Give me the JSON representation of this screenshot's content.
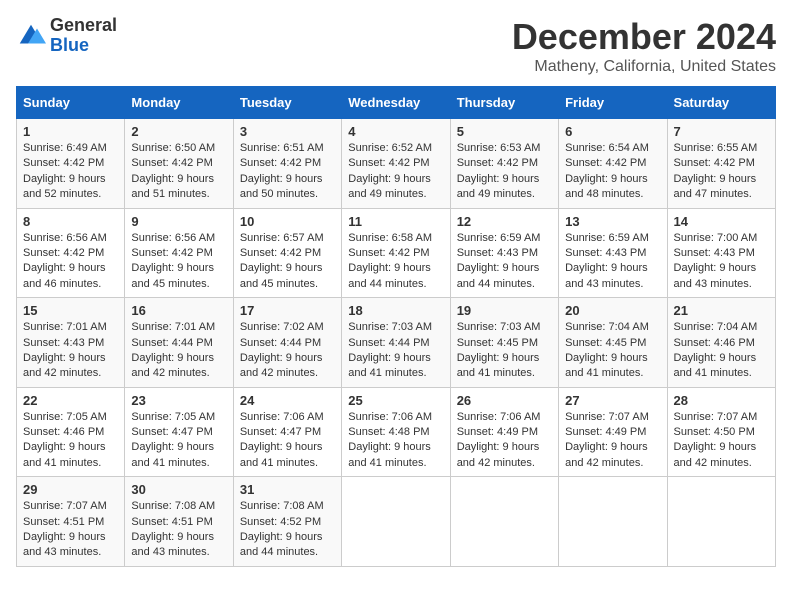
{
  "header": {
    "logo_general": "General",
    "logo_blue": "Blue",
    "title": "December 2024",
    "subtitle": "Matheny, California, United States"
  },
  "columns": [
    "Sunday",
    "Monday",
    "Tuesday",
    "Wednesday",
    "Thursday",
    "Friday",
    "Saturday"
  ],
  "weeks": [
    [
      {
        "day": "1",
        "sunrise": "6:49 AM",
        "sunset": "4:42 PM",
        "daylight": "9 hours and 52 minutes."
      },
      {
        "day": "2",
        "sunrise": "6:50 AM",
        "sunset": "4:42 PM",
        "daylight": "9 hours and 51 minutes."
      },
      {
        "day": "3",
        "sunrise": "6:51 AM",
        "sunset": "4:42 PM",
        "daylight": "9 hours and 50 minutes."
      },
      {
        "day": "4",
        "sunrise": "6:52 AM",
        "sunset": "4:42 PM",
        "daylight": "9 hours and 49 minutes."
      },
      {
        "day": "5",
        "sunrise": "6:53 AM",
        "sunset": "4:42 PM",
        "daylight": "9 hours and 49 minutes."
      },
      {
        "day": "6",
        "sunrise": "6:54 AM",
        "sunset": "4:42 PM",
        "daylight": "9 hours and 48 minutes."
      },
      {
        "day": "7",
        "sunrise": "6:55 AM",
        "sunset": "4:42 PM",
        "daylight": "9 hours and 47 minutes."
      }
    ],
    [
      {
        "day": "8",
        "sunrise": "6:56 AM",
        "sunset": "4:42 PM",
        "daylight": "9 hours and 46 minutes."
      },
      {
        "day": "9",
        "sunrise": "6:56 AM",
        "sunset": "4:42 PM",
        "daylight": "9 hours and 45 minutes."
      },
      {
        "day": "10",
        "sunrise": "6:57 AM",
        "sunset": "4:42 PM",
        "daylight": "9 hours and 45 minutes."
      },
      {
        "day": "11",
        "sunrise": "6:58 AM",
        "sunset": "4:42 PM",
        "daylight": "9 hours and 44 minutes."
      },
      {
        "day": "12",
        "sunrise": "6:59 AM",
        "sunset": "4:43 PM",
        "daylight": "9 hours and 44 minutes."
      },
      {
        "day": "13",
        "sunrise": "6:59 AM",
        "sunset": "4:43 PM",
        "daylight": "9 hours and 43 minutes."
      },
      {
        "day": "14",
        "sunrise": "7:00 AM",
        "sunset": "4:43 PM",
        "daylight": "9 hours and 43 minutes."
      }
    ],
    [
      {
        "day": "15",
        "sunrise": "7:01 AM",
        "sunset": "4:43 PM",
        "daylight": "9 hours and 42 minutes."
      },
      {
        "day": "16",
        "sunrise": "7:01 AM",
        "sunset": "4:44 PM",
        "daylight": "9 hours and 42 minutes."
      },
      {
        "day": "17",
        "sunrise": "7:02 AM",
        "sunset": "4:44 PM",
        "daylight": "9 hours and 42 minutes."
      },
      {
        "day": "18",
        "sunrise": "7:03 AM",
        "sunset": "4:44 PM",
        "daylight": "9 hours and 41 minutes."
      },
      {
        "day": "19",
        "sunrise": "7:03 AM",
        "sunset": "4:45 PM",
        "daylight": "9 hours and 41 minutes."
      },
      {
        "day": "20",
        "sunrise": "7:04 AM",
        "sunset": "4:45 PM",
        "daylight": "9 hours and 41 minutes."
      },
      {
        "day": "21",
        "sunrise": "7:04 AM",
        "sunset": "4:46 PM",
        "daylight": "9 hours and 41 minutes."
      }
    ],
    [
      {
        "day": "22",
        "sunrise": "7:05 AM",
        "sunset": "4:46 PM",
        "daylight": "9 hours and 41 minutes."
      },
      {
        "day": "23",
        "sunrise": "7:05 AM",
        "sunset": "4:47 PM",
        "daylight": "9 hours and 41 minutes."
      },
      {
        "day": "24",
        "sunrise": "7:06 AM",
        "sunset": "4:47 PM",
        "daylight": "9 hours and 41 minutes."
      },
      {
        "day": "25",
        "sunrise": "7:06 AM",
        "sunset": "4:48 PM",
        "daylight": "9 hours and 41 minutes."
      },
      {
        "day": "26",
        "sunrise": "7:06 AM",
        "sunset": "4:49 PM",
        "daylight": "9 hours and 42 minutes."
      },
      {
        "day": "27",
        "sunrise": "7:07 AM",
        "sunset": "4:49 PM",
        "daylight": "9 hours and 42 minutes."
      },
      {
        "day": "28",
        "sunrise": "7:07 AM",
        "sunset": "4:50 PM",
        "daylight": "9 hours and 42 minutes."
      }
    ],
    [
      {
        "day": "29",
        "sunrise": "7:07 AM",
        "sunset": "4:51 PM",
        "daylight": "9 hours and 43 minutes."
      },
      {
        "day": "30",
        "sunrise": "7:08 AM",
        "sunset": "4:51 PM",
        "daylight": "9 hours and 43 minutes."
      },
      {
        "day": "31",
        "sunrise": "7:08 AM",
        "sunset": "4:52 PM",
        "daylight": "9 hours and 44 minutes."
      },
      null,
      null,
      null,
      null
    ]
  ],
  "labels": {
    "sunrise_label": "Sunrise:",
    "sunset_label": "Sunset:",
    "daylight_label": "Daylight:"
  }
}
